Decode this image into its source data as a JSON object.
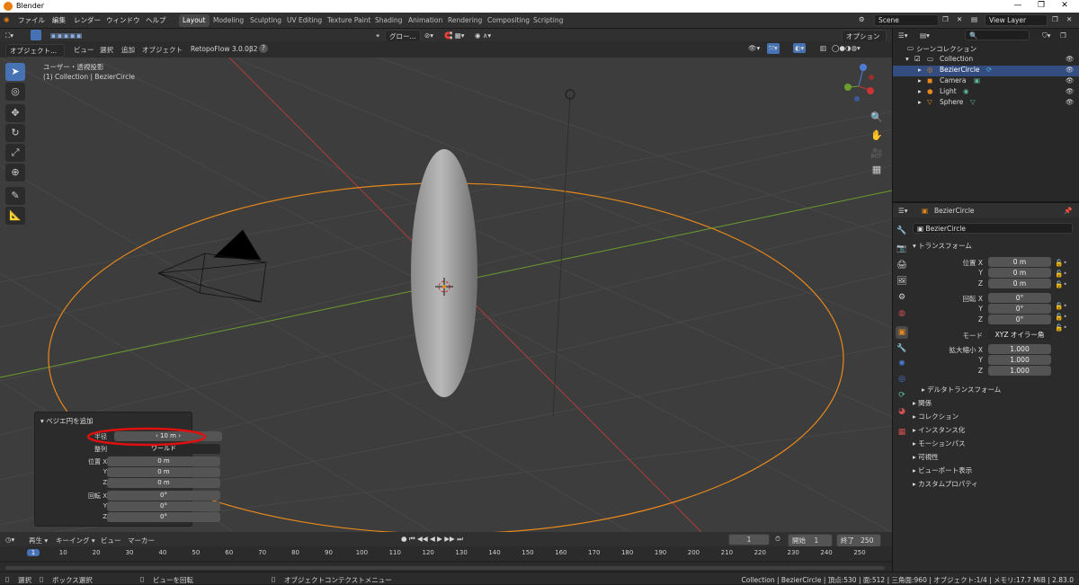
{
  "window": {
    "title": "Blender"
  },
  "menu": {
    "file": "ファイル",
    "edit": "編集",
    "render": "レンダー",
    "window": "ウィンドウ",
    "help": "ヘルプ"
  },
  "workspaces": [
    "Layout",
    "Modeling",
    "Sculpting",
    "UV Editing",
    "Texture Paint",
    "Shading",
    "Animation",
    "Rendering",
    "Compositing",
    "Scripting"
  ],
  "scene": {
    "name": "Scene",
    "view_layer": "View Layer"
  },
  "viewport_header": {
    "mode": "オブジェクト...",
    "view": "ビュー",
    "select": "選択",
    "add": "追加",
    "object": "オブジェクト",
    "addon": "RetopoFlow 3.0.0β2",
    "transform_orientation": "グロー...",
    "options": "オプション"
  },
  "viewport": {
    "view_name": "ユーザー・透視投影",
    "context": "(1) Collection | BezierCircle"
  },
  "outliner": {
    "root": "シーンコレクション",
    "collection": "Collection",
    "items": [
      "BezierCircle",
      "Camera",
      "Light",
      "Sphere"
    ]
  },
  "properties": {
    "object_name_header": "BezierCircle",
    "object_name": "BezierCircle",
    "transform_header": "トランスフォーム",
    "location_label": "位置 X",
    "rotation_label": "回転 X",
    "mode_label": "モード",
    "scale_label": "拡大縮小 X",
    "axis_y": "Y",
    "axis_z": "Z",
    "location": [
      "0 m",
      "0 m",
      "0 m"
    ],
    "rotation": [
      "0°",
      "0°",
      "0°"
    ],
    "rotation_mode": "XYZ オイラー角",
    "scale": [
      "1.000",
      "1.000",
      "1.000"
    ],
    "delta": "デルタトランスフォーム",
    "sections": [
      "関係",
      "コレクション",
      "インスタンス化",
      "モーションパス",
      "可視性",
      "ビューポート表示",
      "カスタムプロパティ"
    ]
  },
  "redo_panel": {
    "title": "ベジエ円を追加",
    "radius_label": "半径",
    "radius_value": "10 m",
    "align_label": "整列",
    "align_value": "ワールド",
    "location_label": "位置 X",
    "location": [
      "0 m",
      "0 m",
      "0 m"
    ],
    "rotation_label": "回転 X",
    "rotation": [
      "0°",
      "0°",
      "0°"
    ],
    "axis_y": "Y",
    "axis_z": "Z"
  },
  "timeline": {
    "playback": "再生",
    "keying": "キーイング",
    "view": "ビュー",
    "marker": "マーカー",
    "current_frame": "1",
    "start_label": "開始",
    "start": "1",
    "end_label": "終了",
    "end": "250",
    "ticks": [
      "1",
      "10",
      "20",
      "30",
      "40",
      "50",
      "60",
      "70",
      "80",
      "90",
      "100",
      "110",
      "120",
      "130",
      "140",
      "150",
      "160",
      "170",
      "180",
      "190",
      "200",
      "210",
      "220",
      "230",
      "240",
      "250"
    ]
  },
  "statusbar": {
    "select": "選択",
    "box_select": "ボックス選択",
    "rotate_view": "ビューを回転",
    "context_menu": "オブジェクトコンテクストメニュー",
    "stats": "Collection | BezierCircle | 頂点:530 | 面:512 | 三角面:960 | オブジェクト:1/4 | メモリ:17.7 MiB | 2.83.0"
  },
  "colors": {
    "accent": "#4772b3",
    "selection": "#e87d0d",
    "x_axis": "#b03c3c",
    "y_axis": "#6a9e2e"
  }
}
